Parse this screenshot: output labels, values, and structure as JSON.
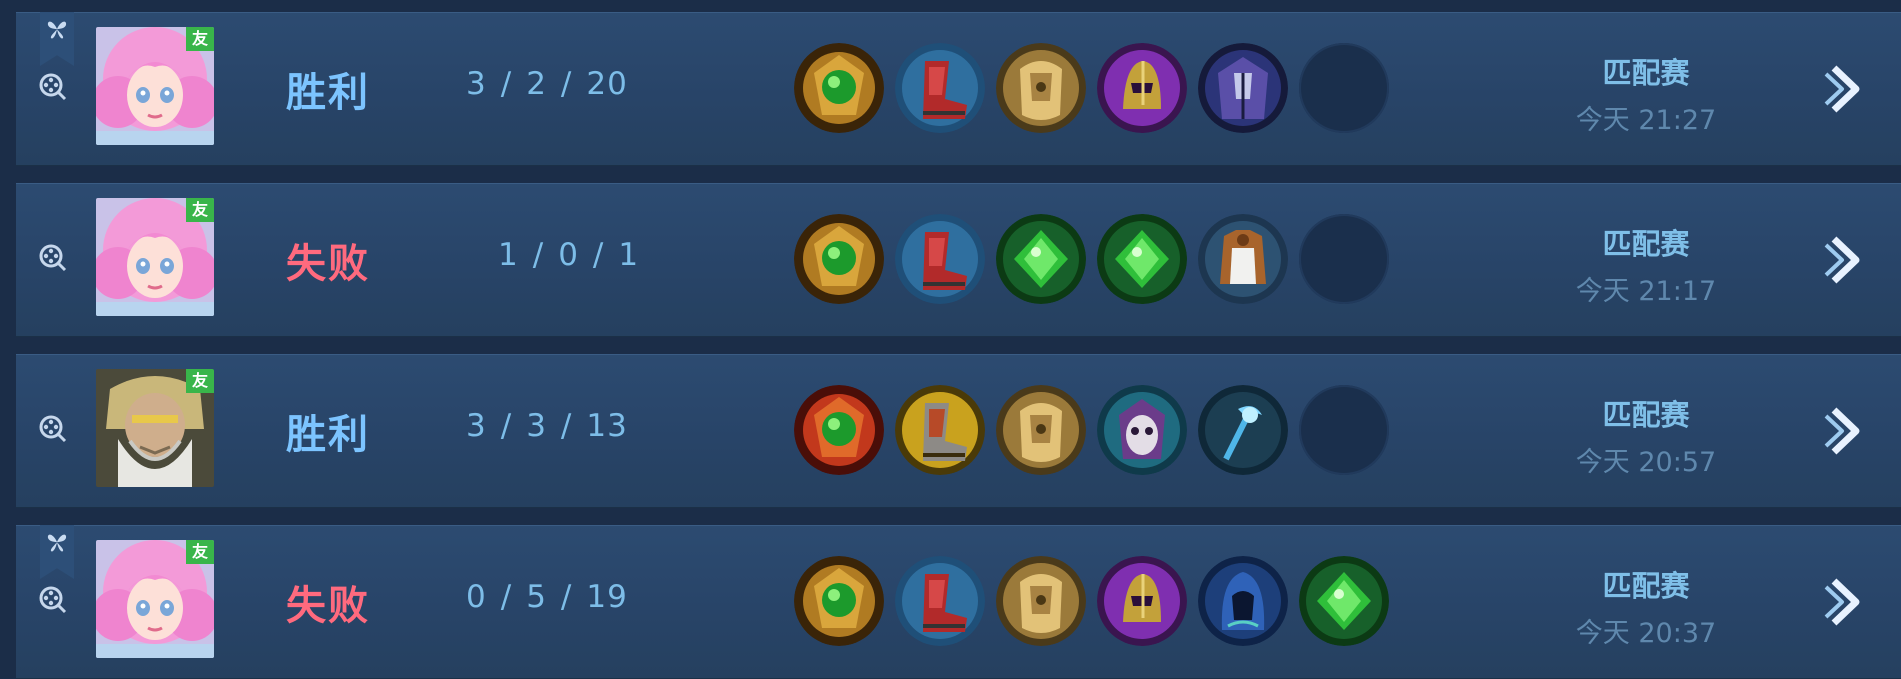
{
  "friend_label": "友",
  "matches": [
    {
      "result": "胜利",
      "outcome": "win",
      "bookmarked": true,
      "kills": "3",
      "deaths": "2",
      "assists": "20",
      "hero_icon": "pink-hair-girl-avatar",
      "items": [
        "emerald-gold-amulet-icon",
        "red-boots-icon",
        "gold-armor-icon",
        "purple-helmet-icon",
        "dark-cloak-icon",
        "empty-slot"
      ],
      "mode": "匹配赛",
      "time": "今天 21:27"
    },
    {
      "result": "失败",
      "outcome": "loss",
      "bookmarked": false,
      "kills": "1",
      "deaths": "0",
      "assists": "1",
      "hero_icon": "pink-hair-girl-avatar",
      "items": [
        "emerald-gold-amulet-icon",
        "red-boots-icon",
        "green-gem-icon",
        "green-gem-icon",
        "white-vest-icon",
        "empty-slot"
      ],
      "mode": "匹配赛",
      "time": "今天 21:17"
    },
    {
      "result": "胜利",
      "outcome": "win",
      "bookmarked": false,
      "kills": "3",
      "deaths": "3",
      "assists": "13",
      "hero_icon": "bearded-sage-avatar",
      "items": [
        "emerald-red-amulet-icon",
        "gold-boots-icon",
        "gold-armor-icon",
        "skull-mask-icon",
        "blue-staff-icon",
        "empty-slot"
      ],
      "mode": "匹配赛",
      "time": "今天 20:57"
    },
    {
      "result": "失败",
      "outcome": "loss",
      "bookmarked": true,
      "kills": "0",
      "deaths": "5",
      "assists": "19",
      "hero_icon": "pink-hair-girl-avatar",
      "items": [
        "emerald-gold-amulet-icon",
        "red-boots-icon",
        "gold-armor-icon",
        "purple-helmet-icon",
        "blue-hood-icon",
        "green-gem-icon"
      ],
      "mode": "匹配赛",
      "time": "今天 20:37"
    }
  ],
  "colors": {
    "win": "#7cc4ff",
    "loss": "#ff6a7e",
    "row_bg": "#2a476c",
    "page_bg": "#1b2d48"
  }
}
